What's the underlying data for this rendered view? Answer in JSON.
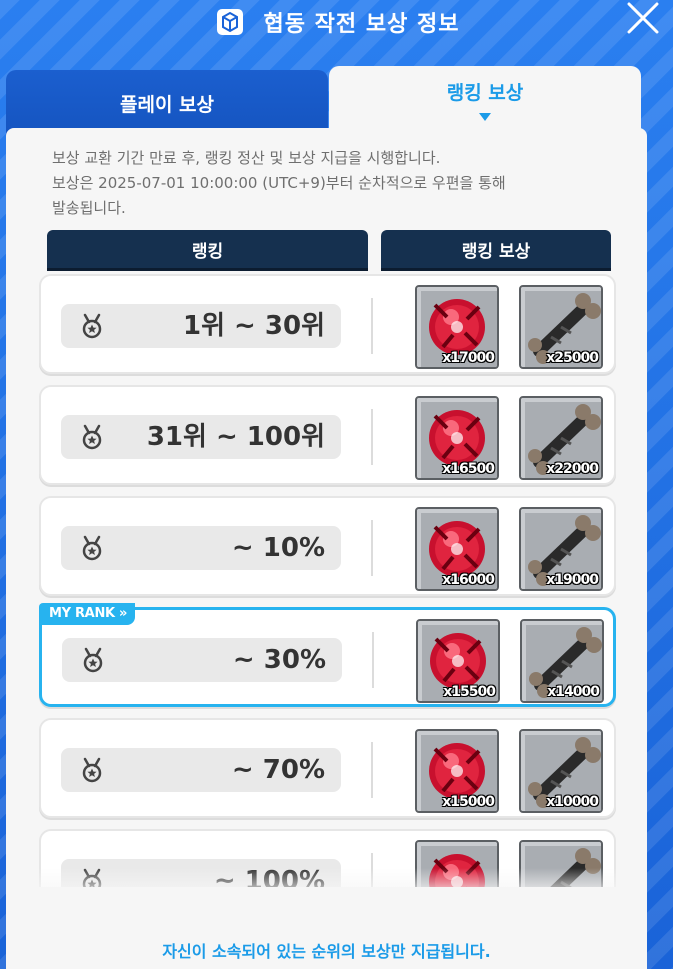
{
  "header": {
    "title": "협동 작전 보상 정보",
    "icon": "box-icon",
    "close_icon": "close-icon"
  },
  "tabs": [
    {
      "label": "플레이 보상",
      "active": false
    },
    {
      "label": "랭킹 보상",
      "active": true
    }
  ],
  "notice": {
    "line1": "보상 교환 기간 만료 후, 랭킹 정산 및 보상 지급을 시행합니다.",
    "line2": "보상은 2025-07-01 10:00:00 (UTC+9)부터 순차적으로 우편을 통해",
    "line3": "발송됩니다."
  },
  "columns": {
    "rank": "랭킹",
    "reward": "랭킹 보상"
  },
  "my_rank_label": "MY RANK »",
  "rows": [
    {
      "rank": "1위 ~ 30위",
      "item1_qty": "x17000",
      "item2_qty": "x25000"
    },
    {
      "rank": "31위 ~ 100위",
      "item1_qty": "x16500",
      "item2_qty": "x22000"
    },
    {
      "rank": "~ 10%",
      "item1_qty": "x16000",
      "item2_qty": "x19000"
    },
    {
      "rank": "~ 30%",
      "item1_qty": "x15500",
      "item2_qty": "x14000"
    },
    {
      "rank": "~ 70%",
      "item1_qty": "x15000",
      "item2_qty": "x10000"
    },
    {
      "rank": "~ 100%",
      "item1_qty": "",
      "item2_qty": ""
    }
  ],
  "footer": {
    "note": "자신이 소속되어 있는 순위의 보상만 지급됩니다."
  },
  "colors": {
    "accent": "#27b3ef",
    "header_bg": "#15304f",
    "background": "#1f6fe0"
  }
}
